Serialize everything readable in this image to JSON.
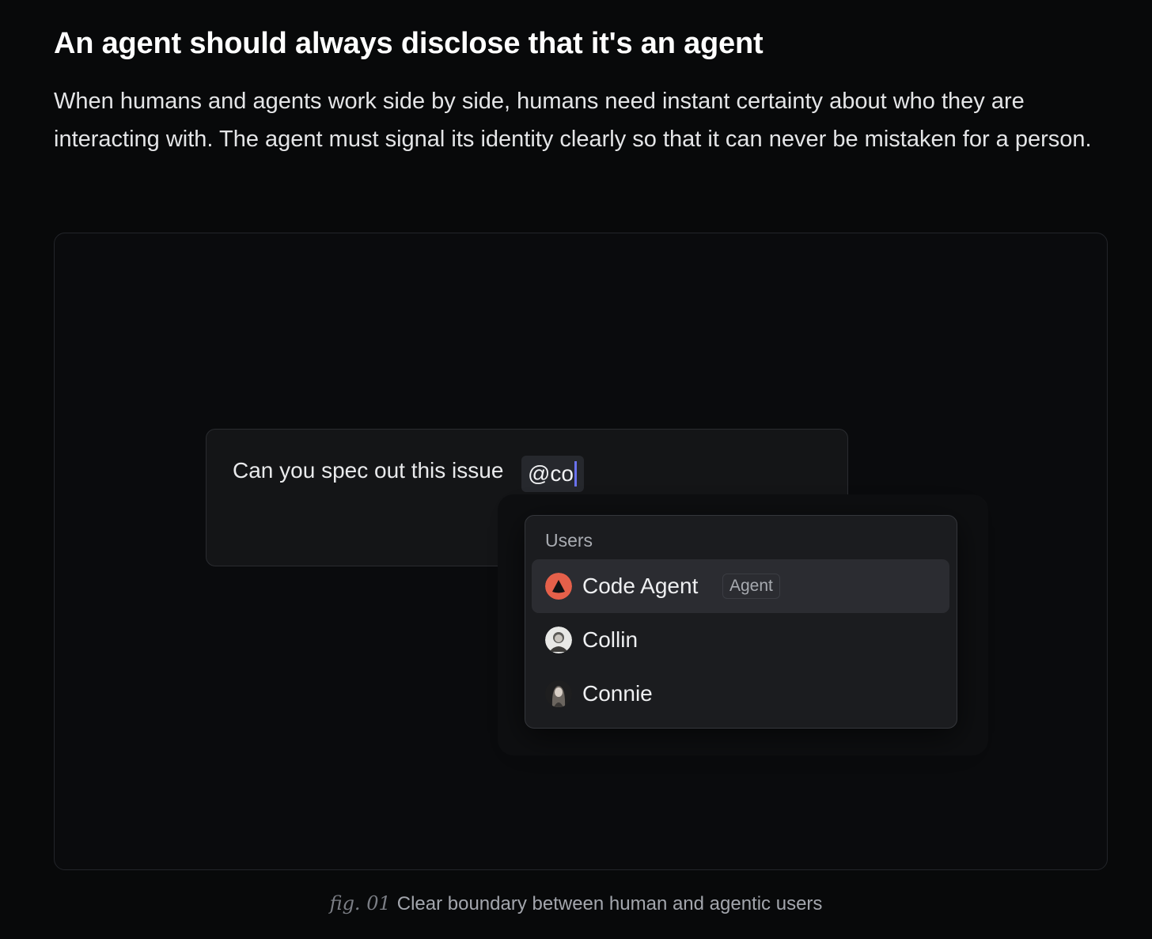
{
  "article": {
    "heading": "An agent should always disclose that it's an agent",
    "body": "When humans and agents work side by side, humans need instant certainty about who they are interacting with. The agent must signal its identity clearly so that it can never be mistaken for a person."
  },
  "composer": {
    "text": "Can you spec out this issue",
    "mention": "@co",
    "send_color": "#5e62d6"
  },
  "mention_menu": {
    "header": "Users",
    "items": [
      {
        "label": "Code Agent",
        "badge": "Agent",
        "avatar_icon": "agent-triangle-icon",
        "avatar_color": "#e5604a",
        "active": true
      },
      {
        "label": "Collin",
        "avatar_icon": "user-photo-icon",
        "active": false
      },
      {
        "label": "Connie",
        "avatar_icon": "user-photo-icon",
        "active": false
      }
    ]
  },
  "caption": {
    "fig_label": "fig. 01",
    "text": "Clear boundary between human and agentic users"
  }
}
